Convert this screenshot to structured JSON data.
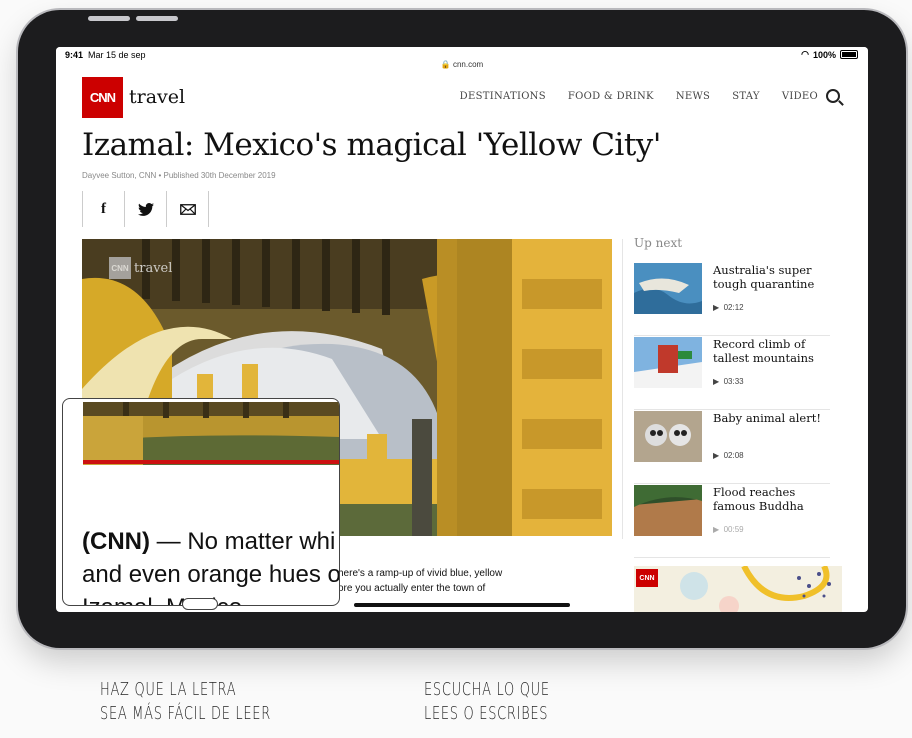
{
  "status_bar": {
    "time": "9:41",
    "date": "Mar 15 de sep",
    "url": "cnn.com",
    "battery": "100%"
  },
  "header": {
    "logo_mark": "CNN",
    "logo_text": "travel",
    "nav": [
      "DESTINATIONS",
      "FOOD & DRINK",
      "NEWS",
      "STAY",
      "VIDEO"
    ]
  },
  "article": {
    "headline": "Izamal: Mexico's magical 'Yellow City'",
    "byline": "Dayvee Sutton, CNN • Published 30th December 2019",
    "share": [
      {
        "icon": "facebook-icon",
        "glyph": "f"
      },
      {
        "icon": "twitter-icon",
        "glyph": "✓"
      },
      {
        "icon": "email-icon",
        "glyph": "✉"
      }
    ],
    "video_watermark_mark": "CNN",
    "video_watermark_text": "travel",
    "body_line1": "here's a ramp-up of vivid blue, yellow",
    "body_line2": "ore you actually enter the town of"
  },
  "upnext": {
    "title": "Up next",
    "items": [
      {
        "title": "Australia's super tough quarantine",
        "duration": "02:12"
      },
      {
        "title": "Record climb of tallest mountains",
        "duration": "03:33"
      },
      {
        "title": "Baby animal alert!",
        "duration": "02:08"
      },
      {
        "title": "Flood reaches famous Buddha",
        "duration": "00:59"
      }
    ]
  },
  "ad": {
    "logo": "CNN"
  },
  "magnifier": {
    "line1_bold": "(CNN)",
    "line1_rest": " — No matter whi",
    "line2": "and even orange hues o",
    "line3": "Izamal, Mexico"
  },
  "captions": {
    "left_line1": "HAZ QUE LA LETRA",
    "left_line2": "SEA MÁS FÁCIL DE LEER",
    "right_line1": "ESCUCHA LO QUE",
    "right_line2": "LEES O ESCRIBES"
  },
  "colors": {
    "brand_red": "#cc0000",
    "yellow_building": "#d9a620"
  }
}
